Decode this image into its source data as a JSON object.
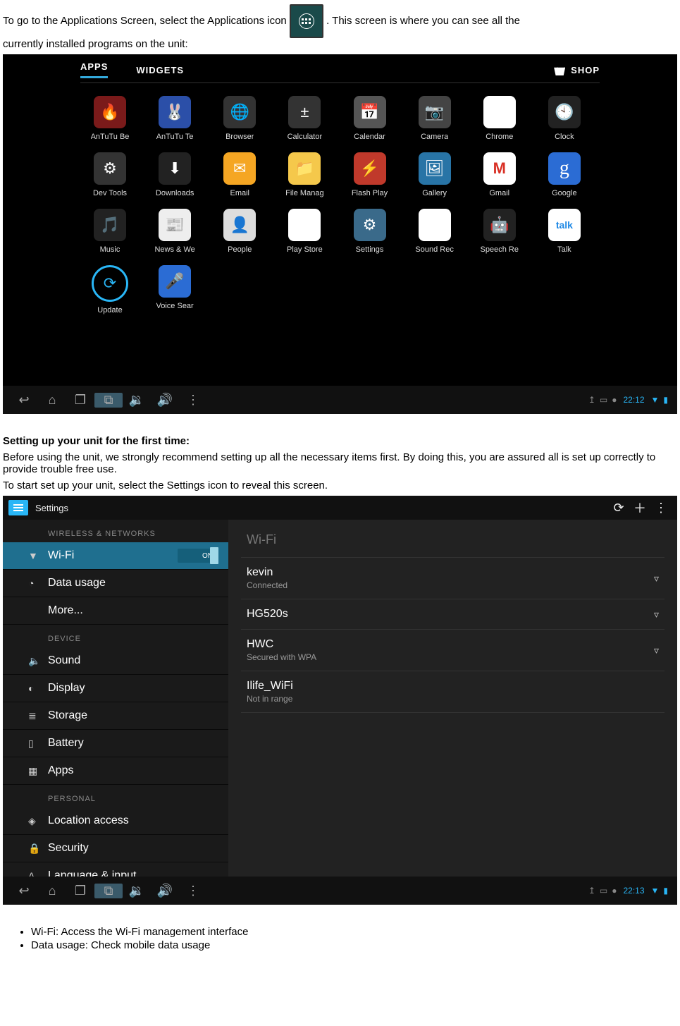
{
  "intro": {
    "line1a": "To go to the Applications Screen, select the Applications icon ",
    "line1b": ". This screen is where you can see all the",
    "line2": "currently installed programs on the unit:"
  },
  "shot1": {
    "tabs": {
      "apps": "APPS",
      "widgets": "WIDGETS"
    },
    "shop": "SHOP",
    "apps": [
      {
        "label": "AnTuTu Be",
        "bg": "#7a1a1a",
        "glyph": "🔥"
      },
      {
        "label": "AnTuTu Te",
        "bg": "#2b4fa8",
        "glyph": "🐰"
      },
      {
        "label": "Browser",
        "bg": "#333",
        "glyph": "🌐"
      },
      {
        "label": "Calculator",
        "bg": "#333",
        "glyph": "±"
      },
      {
        "label": "Calendar",
        "bg": "#555",
        "glyph": "📅"
      },
      {
        "label": "Camera",
        "bg": "#444",
        "glyph": "📷"
      },
      {
        "label": "Chrome",
        "bg": "#fff",
        "glyph": "◉"
      },
      {
        "label": "Clock",
        "bg": "#222",
        "glyph": "🕙"
      },
      {
        "label": "Dev Tools",
        "bg": "#333",
        "glyph": "⚙"
      },
      {
        "label": "Downloads",
        "bg": "#222",
        "glyph": "⬇"
      },
      {
        "label": "Email",
        "bg": "#f5a623",
        "glyph": "✉"
      },
      {
        "label": "File Manag",
        "bg": "#f5c84b",
        "glyph": "📁"
      },
      {
        "label": "Flash Play",
        "bg": "#c0392b",
        "glyph": "⚡"
      },
      {
        "label": "Gallery",
        "bg": "#2874a6",
        "glyph": "🖼"
      },
      {
        "label": "Gmail",
        "bg": "#fff",
        "glyph": "M"
      },
      {
        "label": "Google",
        "bg": "#2b6cd4",
        "glyph": "g"
      },
      {
        "label": "Music",
        "bg": "#222",
        "glyph": "🎵"
      },
      {
        "label": "News & We",
        "bg": "#eee",
        "glyph": "📰"
      },
      {
        "label": "People",
        "bg": "#ddd",
        "glyph": "👤"
      },
      {
        "label": "Play Store",
        "bg": "#fff",
        "glyph": "▶"
      },
      {
        "label": "Settings",
        "bg": "#3a6a8a",
        "glyph": "⚙"
      },
      {
        "label": "Sound Rec",
        "bg": "#fff",
        "glyph": "🎙"
      },
      {
        "label": "Speech Re",
        "bg": "#222",
        "glyph": "🤖"
      },
      {
        "label": "Talk",
        "bg": "#fff",
        "glyph": "talk"
      },
      {
        "label": "Update",
        "bg": "#000",
        "glyph": "⟳"
      },
      {
        "label": "Voice Sear",
        "bg": "#2b6cd4",
        "glyph": "🎤"
      }
    ],
    "status_time": "22:12"
  },
  "section": {
    "heading": "Setting up your unit for the first time:",
    "p1": "Before using the unit, we strongly recommend setting up all the necessary items first. By doing this, you are assured all is set up correctly to provide trouble free use.",
    "p2": "To start set up your unit, select the Settings icon to reveal this screen."
  },
  "shot2": {
    "title": "Settings",
    "side": {
      "hdr1": "WIRELESS & NETWORKS",
      "wifi": "Wi-Fi",
      "wifi_toggle": "ON",
      "data": "Data usage",
      "more": "More...",
      "hdr2": "DEVICE",
      "sound": "Sound",
      "display": "Display",
      "storage": "Storage",
      "battery": "Battery",
      "apps": "Apps",
      "hdr3": "PERSONAL",
      "loc": "Location access",
      "sec": "Security",
      "lang": "Language & input"
    },
    "main_hdr": "Wi-Fi",
    "networks": [
      {
        "name": "kevin",
        "sub": "Connected",
        "sig": "▿"
      },
      {
        "name": "HG520s",
        "sub": "",
        "sig": "▿"
      },
      {
        "name": "HWC",
        "sub": "Secured with WPA",
        "sig": "▿"
      },
      {
        "name": "Ilife_WiFi",
        "sub": "Not in range",
        "sig": ""
      }
    ],
    "status_time": "22:13"
  },
  "bullets": {
    "b1": "Wi-Fi: Access the Wi-Fi management interface",
    "b2": "Data usage: Check mobile data usage"
  }
}
